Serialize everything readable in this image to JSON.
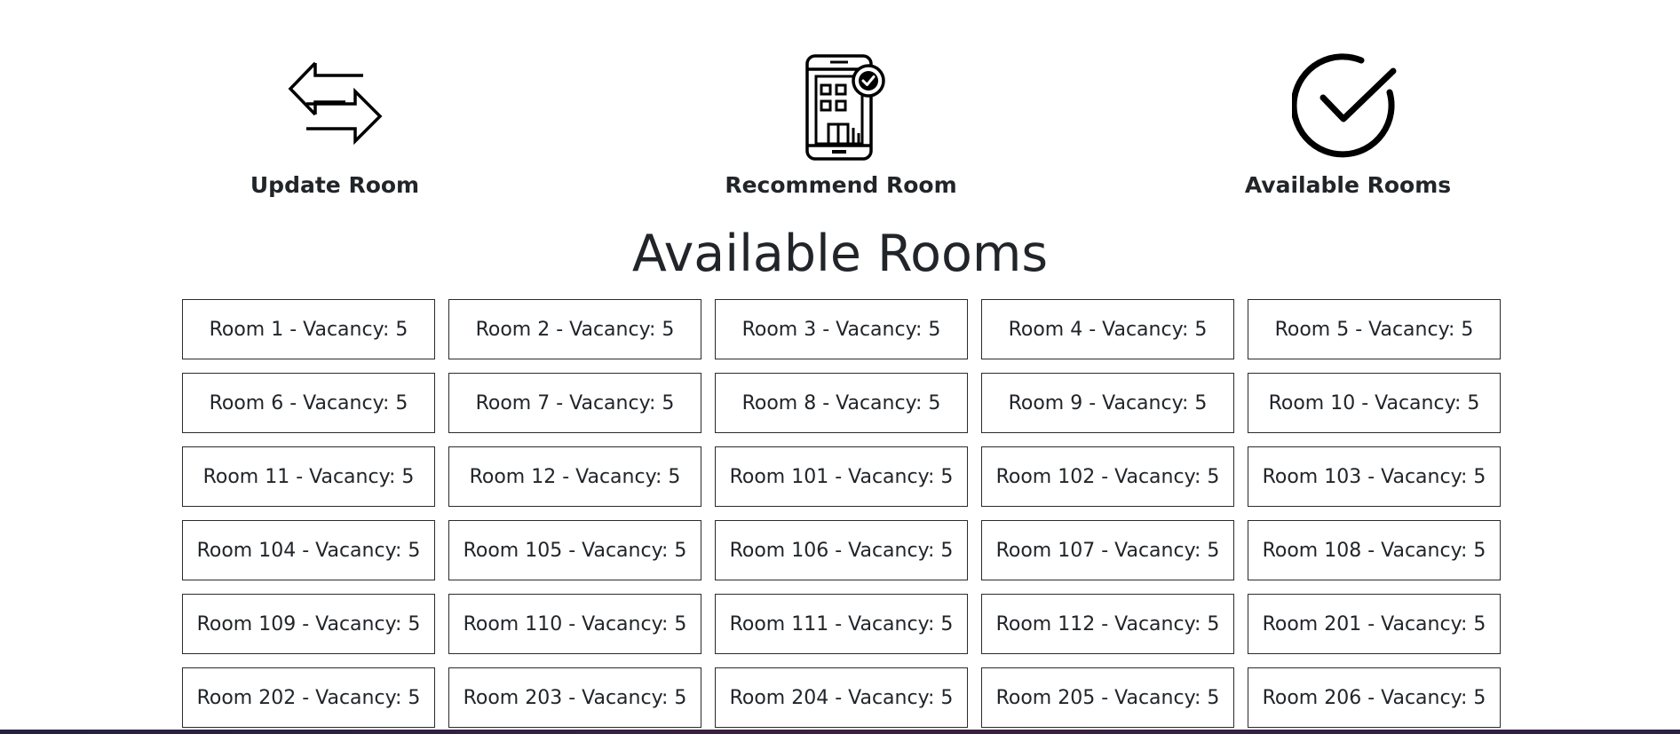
{
  "nav": {
    "update": {
      "label": "Update Room",
      "icon": "swap-arrows-icon"
    },
    "recommend": {
      "label": "Recommend Room",
      "icon": "phone-building-check-icon"
    },
    "available": {
      "label": "Available Rooms",
      "icon": "checkmark-circle-icon"
    }
  },
  "main": {
    "title": "Available Rooms",
    "rooms": [
      "Room 1 - Vacancy: 5",
      "Room 2 - Vacancy: 5",
      "Room 3 - Vacancy: 5",
      "Room 4 - Vacancy: 5",
      "Room 5 - Vacancy: 5",
      "Room 6 - Vacancy: 5",
      "Room 7 - Vacancy: 5",
      "Room 8 - Vacancy: 5",
      "Room 9 - Vacancy: 5",
      "Room 10 - Vacancy: 5",
      "Room 11 - Vacancy: 5",
      "Room 12 - Vacancy: 5",
      "Room 101 - Vacancy: 5",
      "Room 102 - Vacancy: 5",
      "Room 103 - Vacancy: 5",
      "Room 104 - Vacancy: 5",
      "Room 105 - Vacancy: 5",
      "Room 106 - Vacancy: 5",
      "Room 107 - Vacancy: 5",
      "Room 108 - Vacancy: 5",
      "Room 109 - Vacancy: 5",
      "Room 110 - Vacancy: 5",
      "Room 111 - Vacancy: 5",
      "Room 112 - Vacancy: 5",
      "Room 201 - Vacancy: 5",
      "Room 202 - Vacancy: 5",
      "Room 203 - Vacancy: 5",
      "Room 204 - Vacancy: 5",
      "Room 205 - Vacancy: 5",
      "Room 206 - Vacancy: 5"
    ]
  },
  "colors": {
    "text": "#212529",
    "border": "#2b2b2b",
    "bottom_bar": "#2a2141"
  }
}
